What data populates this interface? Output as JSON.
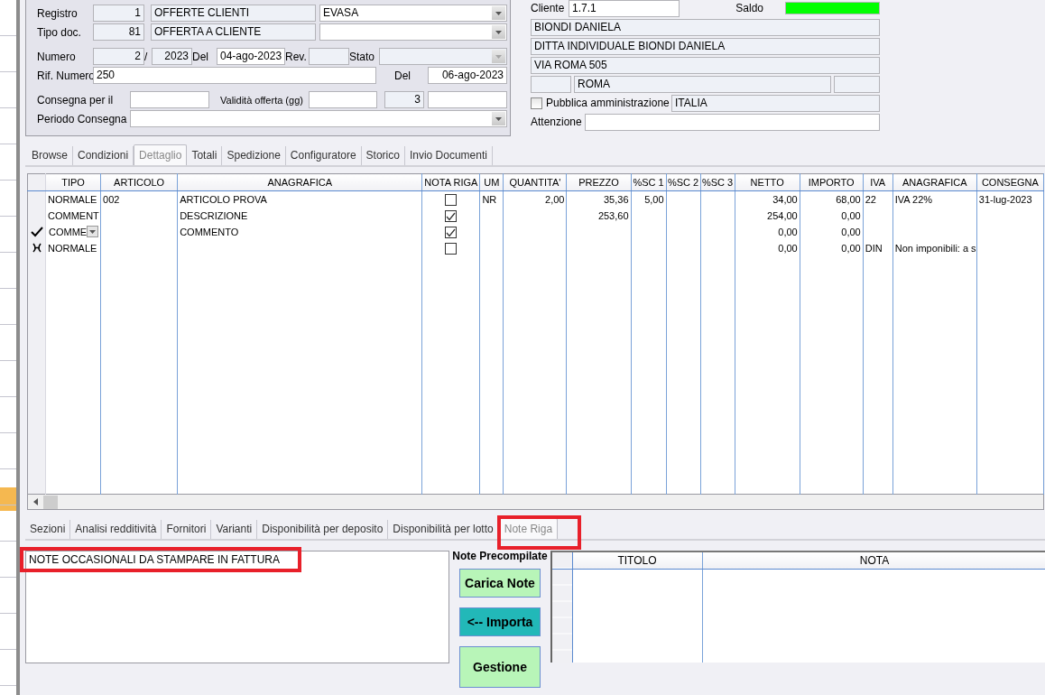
{
  "document": {
    "registro": {
      "label": "Registro",
      "code": "1",
      "description": "OFFERTE CLIENTI",
      "status": "EVASA"
    },
    "tipo_doc": {
      "label": "Tipo doc.",
      "code": "81",
      "description": "OFFERTA A CLIENTE"
    },
    "numero": {
      "label": "Numero",
      "value": "2",
      "separator": "/",
      "year": "2023",
      "date_label": "Del",
      "date": "04-ago-2023",
      "rev_label": "Rev.",
      "stato_label": "Stato",
      "stato_disabled": true
    },
    "rif_numero": {
      "label": "Rif. Numero",
      "value": "250",
      "date_label": "Del",
      "date": "06-ago-2023"
    },
    "consegna": {
      "label": "Consegna per il",
      "validita_label": "Validità offerta (gg)",
      "validita_value": "3"
    },
    "periodo_consegna": {
      "label": "Periodo Consegna"
    }
  },
  "customer": {
    "label": "Cliente",
    "code": "1.7.1",
    "saldo_label": "Saldo",
    "lines": [
      "BIONDI DANIELA",
      "DITTA INDIVIDUALE BIONDI DANIELA",
      "VIA ROMA 505"
    ],
    "city": "ROMA",
    "pubblica_amministrazione": {
      "label": "Pubblica amministrazione",
      "checked": false
    },
    "country": "ITALIA",
    "attenzione_label": "Attenzione"
  },
  "tabs": [
    {
      "label": "Browse",
      "selected": false
    },
    {
      "label": "Condizioni",
      "selected": false
    },
    {
      "label": "Dettaglio",
      "selected": true
    },
    {
      "label": "Totali",
      "selected": false
    },
    {
      "label": "Spedizione",
      "selected": false
    },
    {
      "label": "Configuratore",
      "selected": false
    },
    {
      "label": "Storico",
      "selected": false
    },
    {
      "label": "Invio Documenti",
      "selected": false
    }
  ],
  "table": {
    "columns": [
      "TIPO",
      "ARTICOLO",
      "ANAGRAFICA",
      "NOTA RIGA",
      "UM",
      "QUANTITA'",
      "PREZZO",
      "%SC 1",
      "%SC 2",
      "%SC 3",
      "NETTO",
      "IMPORTO",
      "IVA",
      "ANAGRAFICA",
      "CONSEGNA"
    ],
    "rows": [
      {
        "editing": false,
        "new_row": false,
        "tipo": "NORMALE",
        "articolo": "002",
        "anagrafica": "ARTICOLO PROVA",
        "nota_riga": false,
        "um": "NR",
        "quantita": "2,00",
        "prezzo": "35,36",
        "sc_1": "5,00",
        "netto": "34,00",
        "importo": "68,00",
        "iva": "22",
        "anagrafica_iva": "IVA 22%",
        "consegna": "31-lug-2023"
      },
      {
        "editing": false,
        "new_row": false,
        "tipo": "COMMENT",
        "anagrafica": "DESCRIZIONE",
        "nota_riga": true,
        "prezzo": "253,60",
        "netto": "254,00",
        "importo": "0,00"
      },
      {
        "editing": true,
        "new_row": false,
        "tipo": "COMME",
        "anagrafica": "COMMENTO",
        "nota_riga": true,
        "netto": "0,00",
        "importo": "0,00"
      },
      {
        "editing": false,
        "new_row": true,
        "tipo": "NORMALE",
        "nota_riga": false,
        "netto": "0,00",
        "importo": "0,00",
        "iva": "DIN",
        "anagrafica_iva": "Non imponibili: a s"
      }
    ]
  },
  "bottom_tabs": [
    {
      "label": "Sezioni",
      "selected": false
    },
    {
      "label": "Analisi redditività",
      "selected": false
    },
    {
      "label": "Fornitori",
      "selected": false
    },
    {
      "label": "Varianti",
      "selected": false
    },
    {
      "label": "Disponibilità per deposito",
      "selected": false
    },
    {
      "label": "Disponibilità per lotto",
      "selected": false
    },
    {
      "label": "Note Riga",
      "selected": true
    }
  ],
  "notes": {
    "text": "NOTE OCCASIONALI DA STAMPARE IN FATTURA",
    "precompiled_label": "Note Precompilate",
    "buttons": [
      {
        "label": "Carica Note",
        "kind": "light"
      },
      {
        "label": "<-- Importa",
        "kind": "teal"
      },
      {
        "label": "Gestione",
        "kind": "light"
      }
    ],
    "columns": [
      "TITOLO",
      "NOTA"
    ]
  }
}
